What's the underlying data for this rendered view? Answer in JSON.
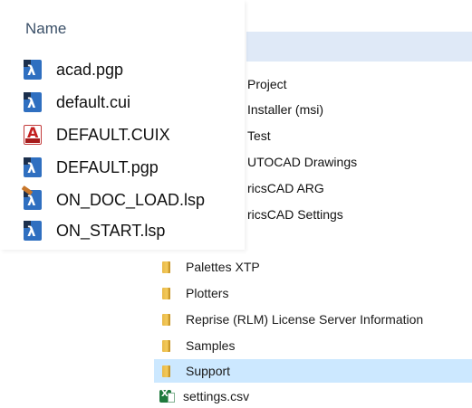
{
  "popup": {
    "column_header": "Name",
    "files": [
      {
        "name": "acad.pgp",
        "icon": "autocad-lisp-file-icon"
      },
      {
        "name": "default.cui",
        "icon": "autocad-lisp-file-icon"
      },
      {
        "name": "DEFAULT.CUIX",
        "icon": "autocad-cuix-file-icon"
      },
      {
        "name": "DEFAULT.pgp",
        "icon": "autocad-lisp-file-icon"
      },
      {
        "name": "ON_DOC_LOAD.lsp",
        "icon": "autocad-lsp-brush-file-icon"
      },
      {
        "name": "ON_START.lsp",
        "icon": "autocad-lisp-file-icon"
      }
    ]
  },
  "background_list": {
    "partial_rows": [
      {
        "text": "Project"
      },
      {
        "text": "Installer (msi)"
      },
      {
        "text": "Test"
      },
      {
        "text": "UTOCAD Drawings"
      },
      {
        "text": "ricsCAD ARG"
      },
      {
        "text": "ricsCAD Settings"
      }
    ],
    "folders": [
      {
        "name": "Palettes XTP",
        "icon": "folder-icon",
        "selected": false
      },
      {
        "name": "Plotters",
        "icon": "folder-icon",
        "selected": false
      },
      {
        "name": "Reprise (RLM) License Server Information",
        "icon": "folder-icon",
        "selected": false
      },
      {
        "name": "Samples",
        "icon": "folder-icon",
        "selected": false
      },
      {
        "name": "Support",
        "icon": "folder-icon",
        "selected": true
      },
      {
        "name": "settings.csv",
        "icon": "excel-csv-icon",
        "selected": false
      }
    ]
  },
  "colors": {
    "selection": "#cce8ff",
    "header_bar": "#dfe9f7",
    "folder": "#f3c95a",
    "autocad_blue": "#2f6fc0"
  }
}
